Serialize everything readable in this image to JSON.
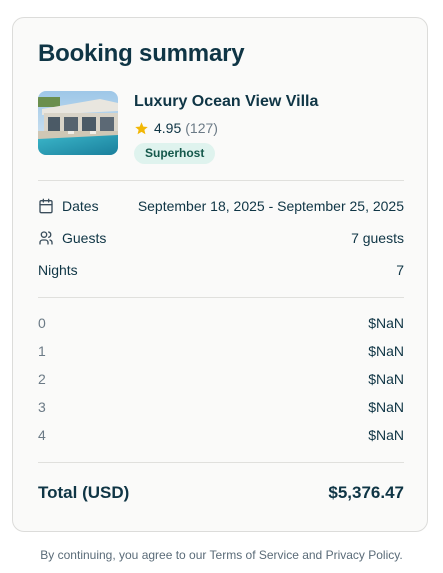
{
  "summary": {
    "title": "Booking summary",
    "property": {
      "name": "Luxury Ocean View Villa",
      "rating": "4.95",
      "reviews": "(127)",
      "badge": "Superhost",
      "image_icon": "villa-photo"
    },
    "details": {
      "dates_label": "Dates",
      "dates_value": "September 18, 2025 - September 25, 2025",
      "guests_label": "Guests",
      "guests_value": "7 guests",
      "nights_label": "Nights",
      "nights_value": "7"
    },
    "price_lines": [
      {
        "label": "0",
        "value": "$NaN"
      },
      {
        "label": "1",
        "value": "$NaN"
      },
      {
        "label": "2",
        "value": "$NaN"
      },
      {
        "label": "3",
        "value": "$NaN"
      },
      {
        "label": "4",
        "value": "$NaN"
      }
    ],
    "total_label": "Total (USD)",
    "total_value": "$5,376.47"
  },
  "footer": {
    "text": "By continuing, you agree to our Terms of Service and Privacy Policy."
  },
  "colors": {
    "text": "#0f3545",
    "muted": "#6b7a86",
    "badge_bg": "#dff3ee",
    "badge_text": "#14584b",
    "star": "#f2b705"
  }
}
